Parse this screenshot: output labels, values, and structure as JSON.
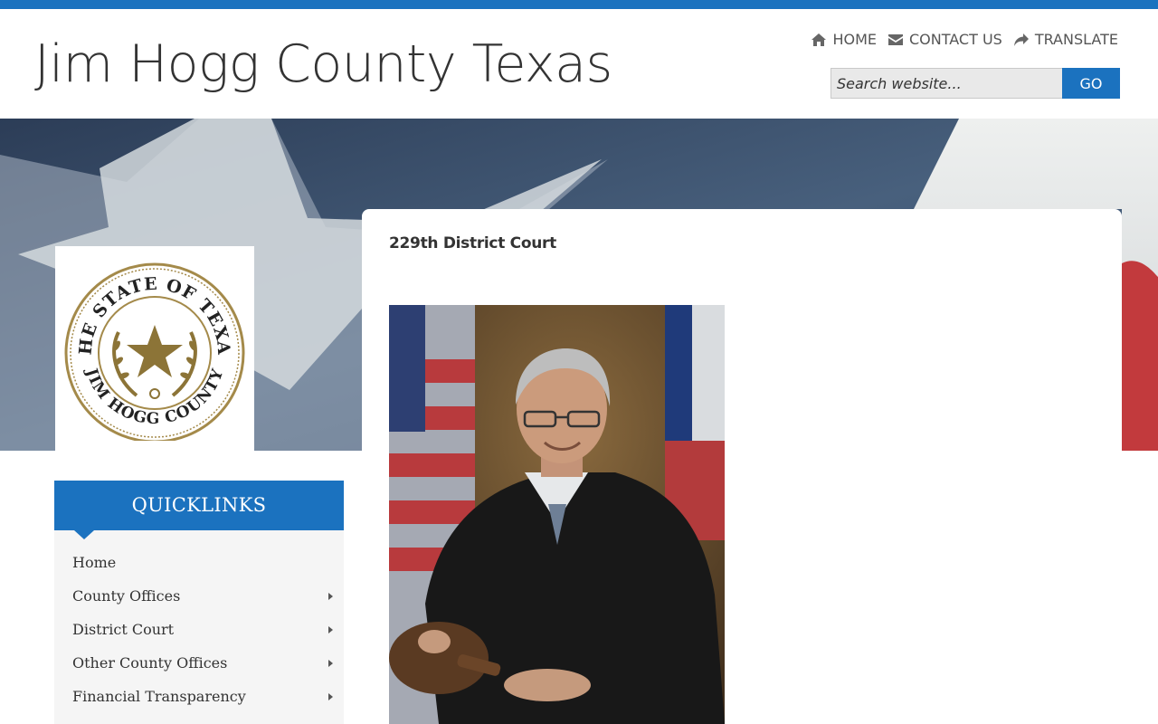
{
  "site": {
    "title": "Jim Hogg County Texas"
  },
  "topnav": {
    "home": "HOME",
    "contact": "CONTACT US",
    "translate": "TRANSLATE"
  },
  "search": {
    "placeholder": "Search website...",
    "button": "GO"
  },
  "seal": {
    "top_text": "THE STATE OF TEXAS",
    "bottom_text": "JIM HOGG COUNTY"
  },
  "content": {
    "title": "229th District Court"
  },
  "quicklinks": {
    "heading": "QUICKLINKS",
    "items": [
      {
        "label": "Home",
        "has_submenu": false
      },
      {
        "label": "County Offices",
        "has_submenu": true
      },
      {
        "label": "District Court",
        "has_submenu": true
      },
      {
        "label": "Other County Offices",
        "has_submenu": true
      },
      {
        "label": "Financial Transparency",
        "has_submenu": true
      }
    ]
  },
  "colors": {
    "accent": "#1b72bf",
    "text": "#333333"
  },
  "icons": [
    "home-icon",
    "envelope-icon",
    "share-icon",
    "caret-right-icon"
  ]
}
